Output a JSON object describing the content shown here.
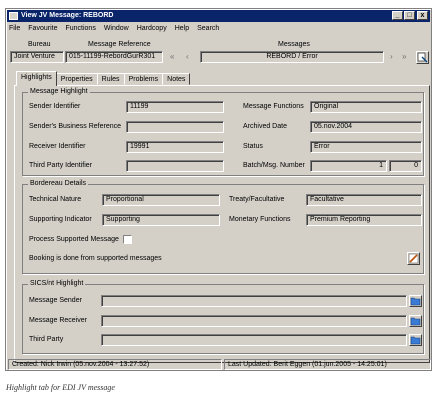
{
  "window": {
    "title": "View JV Message: REBORD",
    "controls": {
      "minimize": "_",
      "maximize": "□",
      "close": "x"
    }
  },
  "menu": [
    {
      "label": "File"
    },
    {
      "label": "Favourite"
    },
    {
      "label": "Functions"
    },
    {
      "label": "Window"
    },
    {
      "label": "Hardcopy"
    },
    {
      "label": "Help"
    },
    {
      "label": "Search"
    }
  ],
  "header": {
    "bureau_label": "Bureau",
    "bureau_value": "Joint Venture",
    "msgref_label": "Message Reference",
    "msgref_value": "015-11199-RebordGurR301",
    "messages_label": "Messages",
    "messages_value": "REBORD / Error",
    "nav": {
      "first": "«",
      "prev": "‹",
      "next": "›",
      "last": "»"
    }
  },
  "tabs": [
    {
      "label": "Highlights",
      "active": true
    },
    {
      "label": "Properties"
    },
    {
      "label": "Rules"
    },
    {
      "label": "Problems"
    },
    {
      "label": "Notes"
    }
  ],
  "message_highlight": {
    "title": "Message Highlight",
    "sender_identifier_label": "Sender Identifier",
    "sender_identifier": "11199",
    "senders_business_reference_label": "Sender's Business Reference",
    "senders_business_reference": "",
    "receiver_identifier_label": "Receiver Identifier",
    "receiver_identifier": "19991",
    "third_party_identifier_label": "Third Party Identifier",
    "third_party_identifier": "",
    "message_functions_label": "Message Functions",
    "message_functions": "Original",
    "archived_date_label": "Archived Date",
    "archived_date": "05.nov.2004",
    "status_label": "Status",
    "status": "Error",
    "batch_msg_number_label": "Batch/Msg. Number",
    "batch_number": "1",
    "msg_number": "0"
  },
  "bordereau_details": {
    "title": "Bordereau Details",
    "technical_nature_label": "Technical Nature",
    "technical_nature": "Proportional",
    "supporting_indicator_label": "Supporting Indicator",
    "supporting_indicator": "Supporting",
    "treaty_facultative_label": "Treaty/Facultative",
    "treaty_facultative": "Facultative",
    "monetary_functions_label": "Monetary Functions",
    "monetary_functions": "Premium Reporting",
    "process_supported_label": "Process Supported Message",
    "booking_note": "Booking is done from supported messages"
  },
  "sics_highlight": {
    "title": "SICS/nt Highlight",
    "message_sender_label": "Message Sender",
    "message_sender": "",
    "message_receiver_label": "Message Receiver",
    "message_receiver": "",
    "third_party_label": "Third Party",
    "third_party": ""
  },
  "statusbar": {
    "created": "Created: Nick Irwin (05.nov.2004 - 13:27:52)",
    "updated": "Last Updated: Berit Eggen (01.jun.2005 - 14:25:01)"
  },
  "caption": "Highlight tab for EDI JV message"
}
